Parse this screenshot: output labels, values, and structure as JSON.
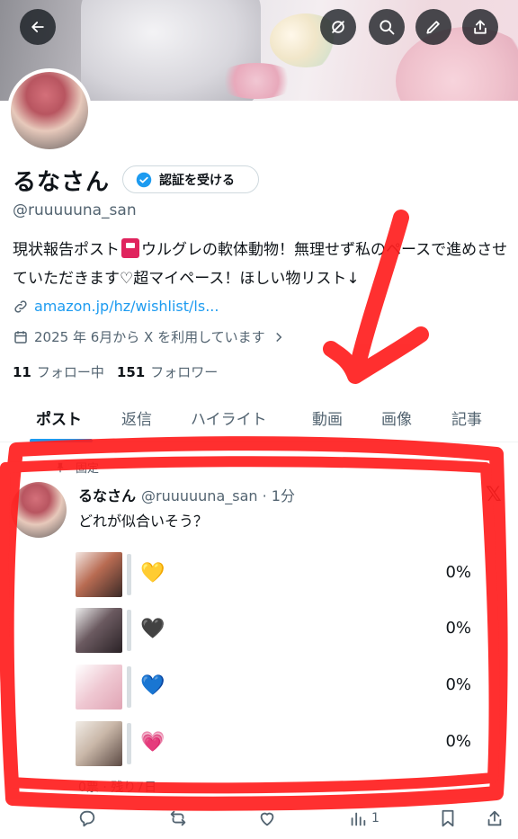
{
  "profile": {
    "name": "るなさん",
    "verify_label": "認証を受ける",
    "handle": "@ruuuuuna_san",
    "bio_before": "現状報告ポスト",
    "bio_after": "ウルグレの軟体動物！無理せず私のペースで進めさせていただきます♡超マイペース！ほしい物リスト↓",
    "link": "amazon.jp/hz/wishlist/ls...",
    "joined": "2025 年 6月から X を利用しています",
    "following_count": "11",
    "following_label": "フォロー中",
    "followers_count": "151",
    "followers_label": "フォロワー"
  },
  "tabs": [
    "ポスト",
    "返信",
    "ハイライト",
    "動画",
    "画像",
    "記事"
  ],
  "post": {
    "pinned_label": "固定",
    "name": "るなさん",
    "meta": "@ruuuuuna_san · 1分",
    "text": "どれが似合いそう？",
    "poll": [
      {
        "emoji": "💛",
        "percent": "0%",
        "thumb_color": "#b86b52"
      },
      {
        "emoji": "🖤",
        "percent": "0%",
        "thumb_color": "#6b5a60"
      },
      {
        "emoji": "💙",
        "percent": "0%",
        "thumb_color": "#efc8d2"
      },
      {
        "emoji": "💗",
        "percent": "0%",
        "thumb_color": "#c9b7a8"
      }
    ],
    "votes": "0票 · 残り7日",
    "views": "1"
  },
  "colors": {
    "accent": "#1d9bf0",
    "annotation": "#ff1e1e"
  }
}
